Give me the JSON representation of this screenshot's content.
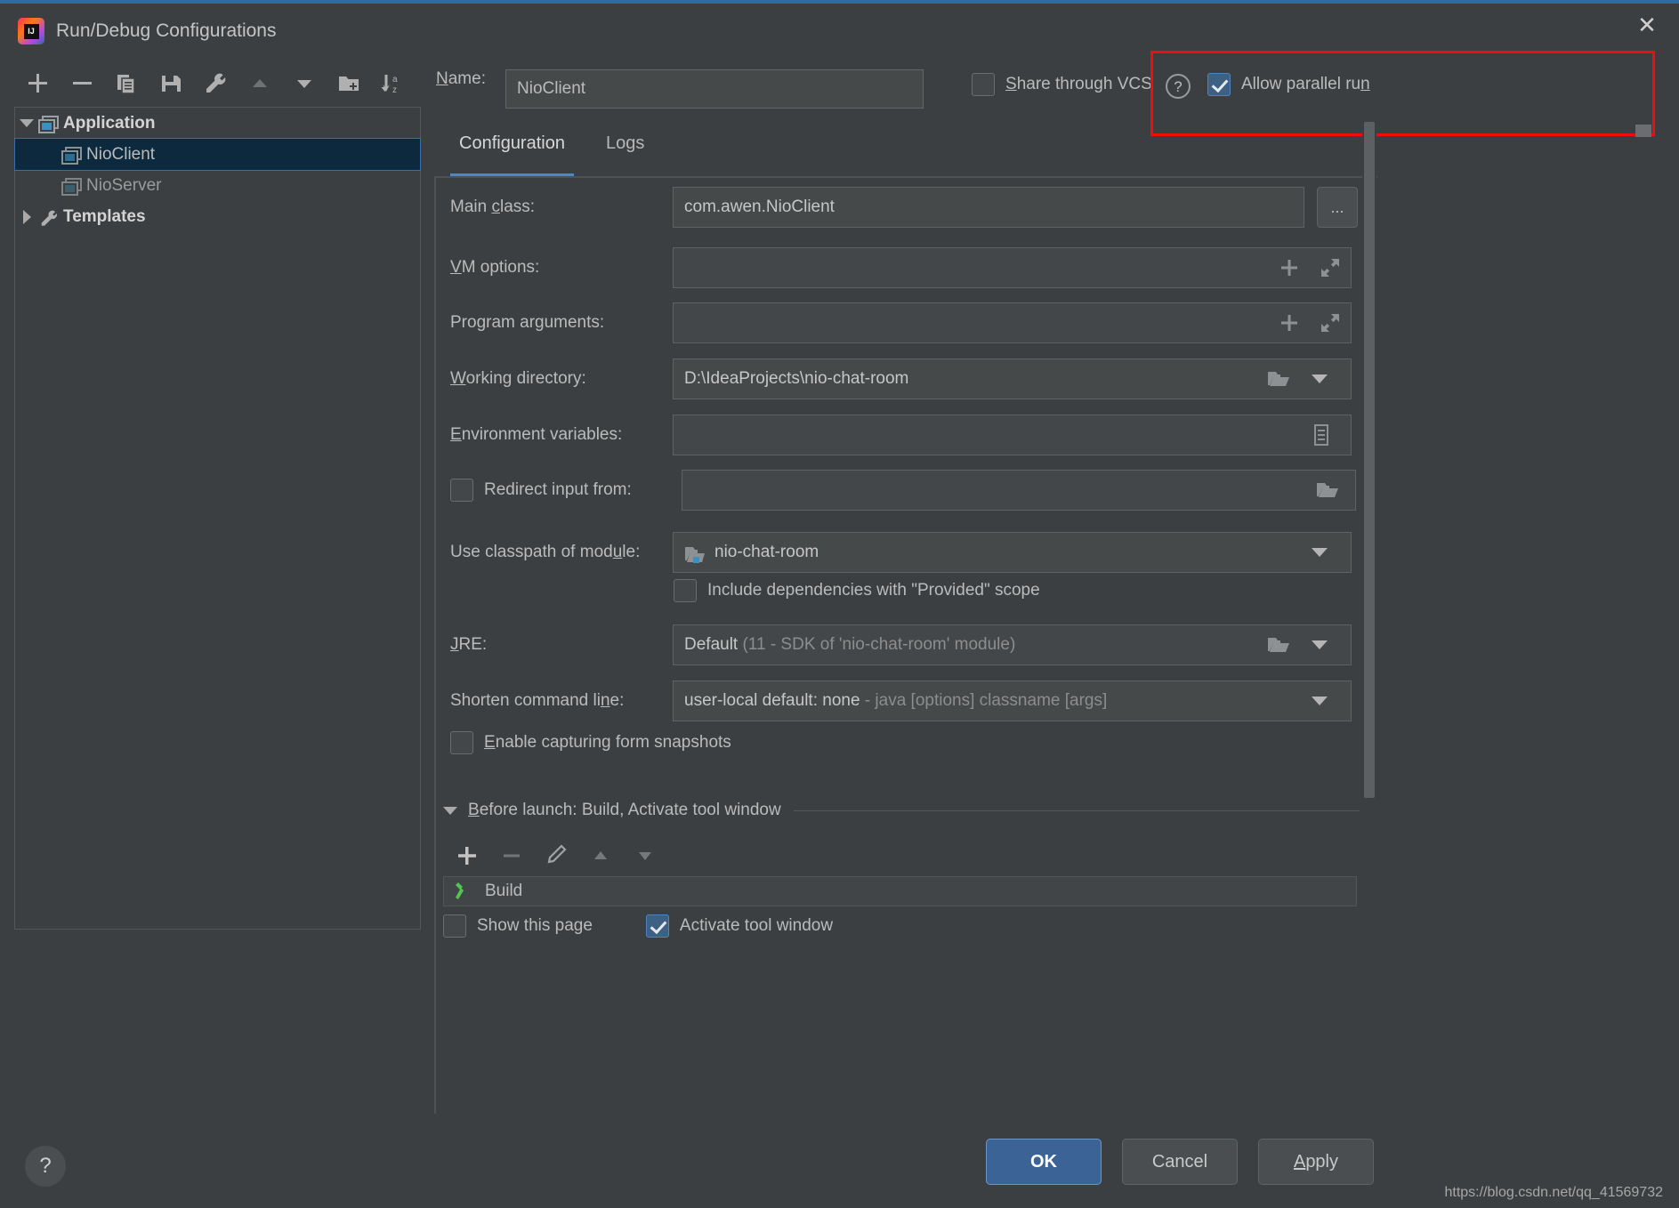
{
  "window": {
    "title": "Run/Debug Configurations",
    "logo_text": "IJ",
    "close_label": "✕"
  },
  "toolbar": {
    "items": [
      {
        "name": "add-icon",
        "tooltip": "Add New Configuration"
      },
      {
        "name": "remove-icon",
        "tooltip": "Remove Configuration"
      },
      {
        "name": "copy-icon",
        "tooltip": "Copy Configuration"
      },
      {
        "name": "save-icon",
        "tooltip": "Save Configuration"
      },
      {
        "name": "edit-templates-icon",
        "tooltip": "Edit Templates"
      },
      {
        "name": "move-up-icon",
        "tooltip": "Move Up"
      },
      {
        "name": "move-down-icon",
        "tooltip": "Move Down"
      },
      {
        "name": "new-folder-icon",
        "tooltip": "Create New Folder"
      },
      {
        "name": "sort-alpha-icon",
        "tooltip": "Sort Configurations"
      }
    ]
  },
  "tree": {
    "nodes": [
      {
        "label": "Application",
        "level": 0,
        "expanded": true,
        "selected": false,
        "icon": "application-icon",
        "bold": true
      },
      {
        "label": "NioClient",
        "level": 1,
        "expanded": false,
        "selected": true,
        "icon": "application-icon",
        "bold": false
      },
      {
        "label": "NioServer",
        "level": 1,
        "expanded": false,
        "selected": false,
        "icon": "application-icon",
        "bold": false
      },
      {
        "label": "Templates",
        "level": 0,
        "expanded": false,
        "selected": false,
        "icon": "wrench-icon",
        "bold": true
      }
    ]
  },
  "header": {
    "name_label": "Name:",
    "name_accel": "N",
    "name_value": "NioClient",
    "share_label": "Share through VCS",
    "share_accel": "S",
    "share_checked": false,
    "help_icon_label": "?",
    "parallel_label": "Allow parallel run",
    "parallel_accel": "n",
    "parallel_checked": true,
    "highlight_color": "#f40b0b"
  },
  "tabs": [
    {
      "label": "Configuration",
      "active": true
    },
    {
      "label": "Logs",
      "active": false
    }
  ],
  "form": {
    "main_class": {
      "label": "Main class:",
      "accel": "c",
      "value": "com.awen.NioClient",
      "browse_label": "...",
      "browse_icon": "ellipsis-icon"
    },
    "vm_options": {
      "label": "VM options:",
      "accel": "V",
      "value": "",
      "icons": [
        "plus-icon",
        "expand-icon"
      ]
    },
    "program_arguments": {
      "label": "Program arguments:",
      "accel": "",
      "value": "",
      "icons": [
        "plus-icon",
        "expand-icon"
      ]
    },
    "working_directory": {
      "label": "Working directory:",
      "accel": "W",
      "value": "D:\\IdeaProjects\\nio-chat-room",
      "icons": [
        "folder-icon",
        "chevron-down-icon"
      ]
    },
    "environment_variables": {
      "label": "Environment variables:",
      "accel": "E",
      "value": "",
      "icons": [
        "list-icon"
      ]
    },
    "redirect_input": {
      "label": "Redirect input from:",
      "checked": false,
      "value": "",
      "icons": [
        "folder-icon"
      ]
    },
    "classpath_module": {
      "label": "Use classpath of module:",
      "accel": "u",
      "value": "nio-chat-room",
      "value_icon": "module-folder-icon",
      "icons": [
        "chevron-down-icon"
      ]
    },
    "include_provided": {
      "label": "Include dependencies with \"Provided\" scope",
      "checked": false
    },
    "jre": {
      "label": "JRE:",
      "accel": "J",
      "value": "Default",
      "value_hint": "(11 - SDK of 'nio-chat-room' module)",
      "icons": [
        "folder-icon",
        "chevron-down-icon"
      ]
    },
    "shorten_command_line": {
      "label": "Shorten command line:",
      "accel": "n",
      "value": "user-local default: none",
      "value_hint": "- java [options] classname [args]",
      "icons": [
        "chevron-down-icon"
      ]
    },
    "form_snapshots": {
      "label": "Enable capturing form snapshots",
      "accel": "E",
      "checked": false
    }
  },
  "before_launch": {
    "header": "Before launch: Build, Activate tool window",
    "accel": "B",
    "expanded": true,
    "toolbar": [
      {
        "name": "add-task-icon"
      },
      {
        "name": "remove-task-icon"
      },
      {
        "name": "edit-task-icon"
      },
      {
        "name": "move-task-up-icon"
      },
      {
        "name": "move-task-down-icon"
      }
    ],
    "tasks": [
      {
        "label": "Build",
        "icon": "build-hammer-icon",
        "icon_color": "#52c552"
      }
    ],
    "options": [
      {
        "label": "Show this page",
        "checked": false
      },
      {
        "label": "Activate tool window",
        "checked": true
      }
    ]
  },
  "footer": {
    "help_label": "?",
    "ok_label": "OK",
    "cancel_label": "Cancel",
    "apply_label": "Apply",
    "apply_accel": "A",
    "watermark": "https://blog.csdn.net/qq_41569732"
  }
}
